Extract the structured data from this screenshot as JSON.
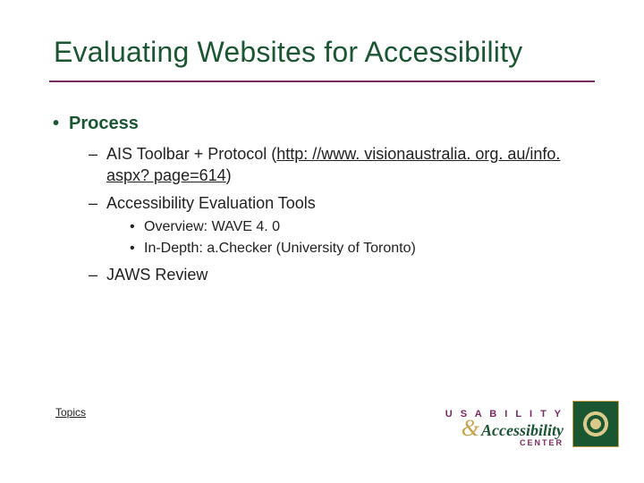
{
  "title": "Evaluating Websites for Accessibility",
  "process": {
    "heading": "Process",
    "items": {
      "ais": {
        "label_pre": "AIS Toolbar + Protocol (",
        "url": "http: //www. visionaustralia. org. au/info. aspx? page=614",
        "label_post": ")"
      },
      "tools": {
        "label": "Accessibility Evaluation Tools",
        "sub": {
          "overview": "Overview: WAVE 4. 0",
          "indepth": "In-Depth: a.Checker (University of Toronto)"
        }
      },
      "jaws": "JAWS Review"
    }
  },
  "footer": {
    "topics": "Topics",
    "uac": {
      "usability": "U S A B I L I T Y",
      "amp": "&",
      "accessibility": "Accessibility",
      "center": "CENTER"
    }
  }
}
